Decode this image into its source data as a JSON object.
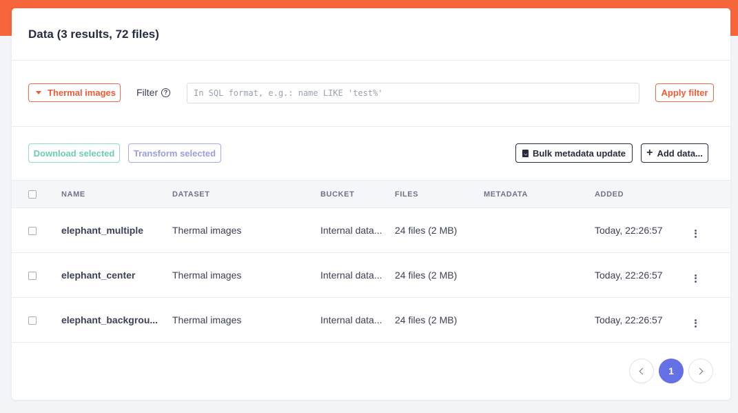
{
  "page": {
    "title": "Data (3 results, 72 files)"
  },
  "filter": {
    "dataset_label": "Thermal images",
    "filter_label": "Filter",
    "help_icon": "question-circle-icon",
    "input_value": "",
    "input_placeholder": "In SQL format, e.g.: name LIKE 'test%'",
    "apply_label": "Apply filter"
  },
  "actions": {
    "download_label": "Download selected",
    "transform_label": "Transform selected",
    "bulk_label": "Bulk metadata update",
    "add_label": "Add data..."
  },
  "table": {
    "columns": [
      "NAME",
      "DATASET",
      "BUCKET",
      "FILES",
      "METADATA",
      "ADDED"
    ],
    "rows": [
      {
        "name": "elephant_multiple",
        "dataset": "Thermal images",
        "bucket": "Internal data...",
        "files": "24 files (2 MB)",
        "metadata": "",
        "added": "Today, 22:26:57"
      },
      {
        "name": "elephant_center",
        "dataset": "Thermal images",
        "bucket": "Internal data...",
        "files": "24 files (2 MB)",
        "metadata": "",
        "added": "Today, 22:26:57"
      },
      {
        "name": "elephant_backgrou...",
        "dataset": "Thermal images",
        "bucket": "Internal data...",
        "files": "24 files (2 MB)",
        "metadata": "",
        "added": "Today, 22:26:57"
      }
    ]
  },
  "pagination": {
    "current_page": "1"
  },
  "colors": {
    "brand": "#f5663b",
    "accent_orange": "#ef5b36",
    "primary": "#6470e6",
    "success": "#6ccfab"
  }
}
